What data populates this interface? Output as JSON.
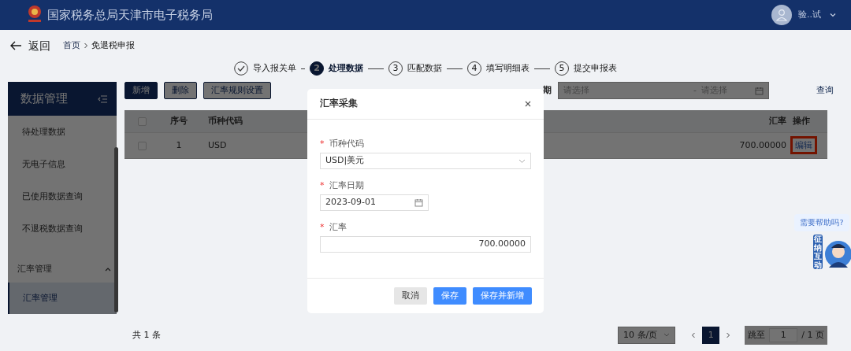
{
  "header": {
    "title": "国家税务总局天津市电子税务局",
    "user": "验..试"
  },
  "nav": {
    "back": "返回",
    "breadcrumb": [
      {
        "label": "首页",
        "kind": "link"
      },
      {
        "label": "免退税申报",
        "kind": "current"
      }
    ]
  },
  "steps": [
    {
      "label": "导入报关单",
      "done": true,
      "selected": false
    },
    {
      "number": "2",
      "label": "处理数据",
      "done": false,
      "selected": true
    },
    {
      "number": "3",
      "label": "匹配数据",
      "done": false,
      "selected": false
    },
    {
      "number": "4",
      "label": "填写明细表",
      "done": false,
      "selected": false
    },
    {
      "number": "5",
      "label": "提交申报表",
      "done": false,
      "selected": false
    }
  ],
  "sidebar": {
    "title": "数据管理",
    "items": [
      {
        "label": "待处理数据",
        "selected": false
      },
      {
        "label": "无电子信息",
        "selected": false
      },
      {
        "label": "已使用数据查询",
        "selected": false
      },
      {
        "label": "不退税数据查询",
        "selected": false
      }
    ],
    "group": {
      "label": "汇率管理",
      "expanded": true,
      "items": [
        {
          "label": "汇率管理",
          "selected": true
        }
      ]
    }
  },
  "toolbar": {
    "buttons": [
      {
        "label": "新增",
        "kind": "primary"
      },
      {
        "label": "删除",
        "kind": "outline"
      },
      {
        "label": "汇率规则设置",
        "kind": "outline"
      }
    ]
  },
  "filter": {
    "label": "期",
    "start_placeholder": "请选择",
    "separator": "-",
    "end_placeholder": "请选择",
    "query": "查询"
  },
  "table": {
    "select_all_checked": false,
    "columns": [
      "序号",
      "币种代码",
      "汇率",
      "操作"
    ],
    "rows": [
      {
        "checked": false,
        "index": "1",
        "code": "USD",
        "rate": "700.00000",
        "action": "编辑",
        "highlighted": true
      }
    ]
  },
  "footer": {
    "total": "共 1 条",
    "page_size": "10 条/页",
    "pages": [
      {
        "label": "1",
        "selected": true
      }
    ],
    "jump_label": "跳至",
    "jump_value": "1",
    "page_total": "/ 1 页"
  },
  "dialog": {
    "title": "汇率采集",
    "fields": [
      {
        "required_mark": "*",
        "label": "币种代码",
        "kind": "select",
        "value": "USD|美元"
      },
      {
        "required_mark": "*",
        "label": "汇率日期",
        "kind": "date",
        "value": "2023-09-01"
      },
      {
        "required_mark": "*",
        "label": "汇率",
        "kind": "number",
        "value": "700.00000"
      }
    ],
    "buttons": [
      {
        "label": "取消",
        "kind": "secondary"
      },
      {
        "label": "保存",
        "kind": "primary"
      },
      {
        "label": "保存并新增",
        "kind": "primary"
      }
    ]
  },
  "help": {
    "bubble": "需要帮助吗?",
    "mascot": "征纳互动"
  }
}
